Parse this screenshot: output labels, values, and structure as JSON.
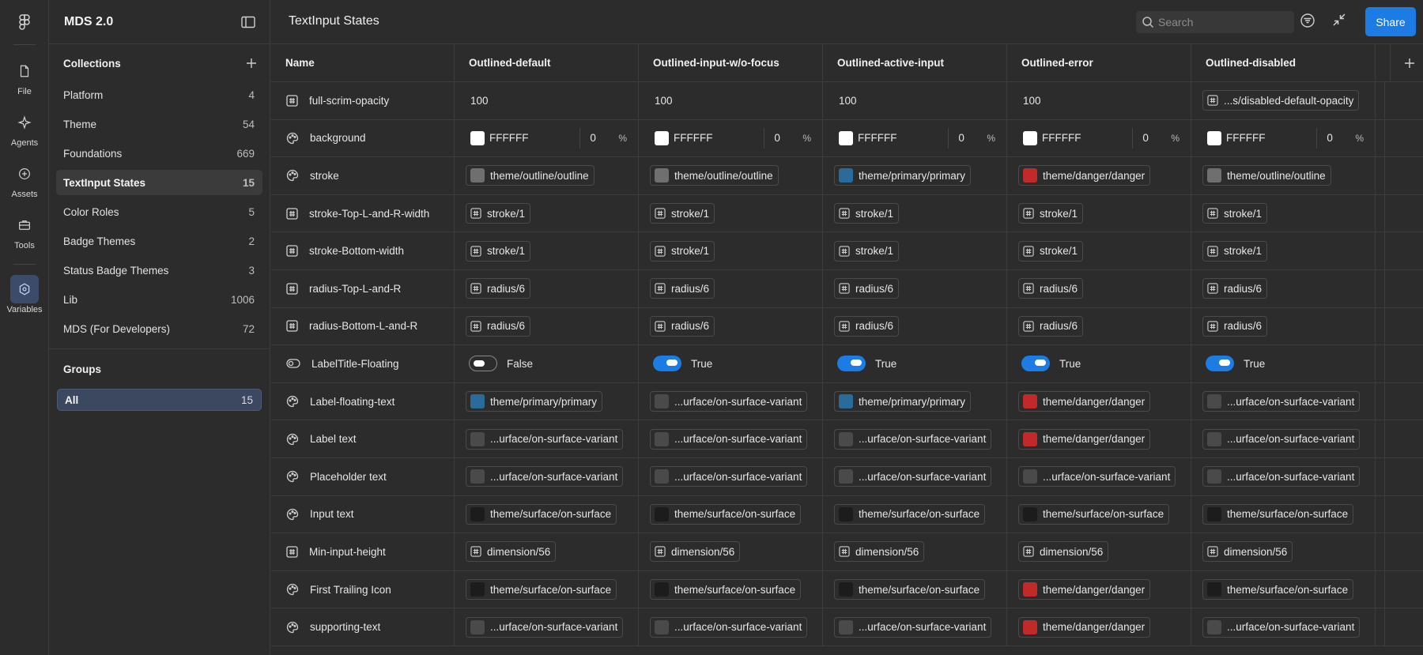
{
  "rail": {
    "items": [
      {
        "label": "File",
        "icon": "file-icon"
      },
      {
        "label": "Agents",
        "icon": "agents-icon"
      },
      {
        "label": "Assets",
        "icon": "assets-icon"
      },
      {
        "label": "Tools",
        "icon": "tools-icon"
      },
      {
        "label": "Variables",
        "icon": "variables-icon"
      }
    ]
  },
  "panel": {
    "title": "MDS 2.0",
    "collections_label": "Collections",
    "collections": [
      {
        "name": "Platform",
        "count": "4"
      },
      {
        "name": "Theme",
        "count": "54"
      },
      {
        "name": "Foundations",
        "count": "669"
      },
      {
        "name": "TextInput States",
        "count": "15"
      },
      {
        "name": "Color Roles",
        "count": "5"
      },
      {
        "name": "Badge Themes",
        "count": "2"
      },
      {
        "name": "Status Badge Themes",
        "count": "3"
      },
      {
        "name": "Lib",
        "count": "1006"
      },
      {
        "name": "MDS (For Developers)",
        "count": "72"
      }
    ],
    "groups_label": "Groups",
    "group_all": {
      "name": "All",
      "count": "15"
    }
  },
  "topbar": {
    "title": "TextInput States",
    "search_placeholder": "Search",
    "share_label": "Share"
  },
  "table": {
    "name_header": "Name",
    "modes": [
      "Outlined-default",
      "Outlined-input-w/o-focus",
      "Outlined-active-input",
      "Outlined-error",
      "Outlined-disabled"
    ],
    "rows": [
      {
        "name": "full-scrim-opacity",
        "type": "number",
        "cells": [
          {
            "kind": "plain",
            "text": "100"
          },
          {
            "kind": "plain",
            "text": "100"
          },
          {
            "kind": "plain",
            "text": "100"
          },
          {
            "kind": "plain",
            "text": "100"
          },
          {
            "kind": "alias",
            "text": "...s/disabled-default-opacity"
          }
        ]
      },
      {
        "name": "background",
        "type": "color",
        "cells": [
          {
            "kind": "color",
            "hex": "FFFFFF",
            "opacity": "0",
            "pct": "%"
          },
          {
            "kind": "color",
            "hex": "FFFFFF",
            "opacity": "0",
            "pct": "%"
          },
          {
            "kind": "color",
            "hex": "FFFFFF",
            "opacity": "0",
            "pct": "%"
          },
          {
            "kind": "color",
            "hex": "FFFFFF",
            "opacity": "0",
            "pct": "%"
          },
          {
            "kind": "color",
            "hex": "FFFFFF",
            "opacity": "0",
            "pct": "%"
          }
        ]
      },
      {
        "name": "stroke",
        "type": "color",
        "cells": [
          {
            "kind": "swatch",
            "text": "theme/outline/outline",
            "swatch": "#6f6f6f"
          },
          {
            "kind": "swatch",
            "text": "theme/outline/outline",
            "swatch": "#6f6f6f"
          },
          {
            "kind": "swatch",
            "text": "theme/primary/primary",
            "swatch": "#2b6b99"
          },
          {
            "kind": "swatch",
            "text": "theme/danger/danger",
            "swatch": "#c22a2a"
          },
          {
            "kind": "swatch",
            "text": "theme/outline/outline",
            "swatch": "#6f6f6f"
          }
        ]
      },
      {
        "name": "stroke-Top-L-and-R-width",
        "type": "number",
        "cells": [
          {
            "kind": "alias",
            "text": "stroke/1"
          },
          {
            "kind": "alias",
            "text": "stroke/1"
          },
          {
            "kind": "alias",
            "text": "stroke/1"
          },
          {
            "kind": "alias",
            "text": "stroke/1"
          },
          {
            "kind": "alias",
            "text": "stroke/1"
          }
        ]
      },
      {
        "name": "stroke-Bottom-width",
        "type": "number",
        "cells": [
          {
            "kind": "alias",
            "text": "stroke/1"
          },
          {
            "kind": "alias",
            "text": "stroke/1"
          },
          {
            "kind": "alias",
            "text": "stroke/1"
          },
          {
            "kind": "alias",
            "text": "stroke/1"
          },
          {
            "kind": "alias",
            "text": "stroke/1"
          }
        ]
      },
      {
        "name": "radius-Top-L-and-R",
        "type": "number",
        "cells": [
          {
            "kind": "alias",
            "text": "radius/6"
          },
          {
            "kind": "alias",
            "text": "radius/6"
          },
          {
            "kind": "alias",
            "text": "radius/6"
          },
          {
            "kind": "alias",
            "text": "radius/6"
          },
          {
            "kind": "alias",
            "text": "radius/6"
          }
        ]
      },
      {
        "name": "radius-Bottom-L-and-R",
        "type": "number",
        "cells": [
          {
            "kind": "alias",
            "text": "radius/6"
          },
          {
            "kind": "alias",
            "text": "radius/6"
          },
          {
            "kind": "alias",
            "text": "radius/6"
          },
          {
            "kind": "alias",
            "text": "radius/6"
          },
          {
            "kind": "alias",
            "text": "radius/6"
          }
        ]
      },
      {
        "name": "LabelTitle-Floating",
        "type": "boolean",
        "cells": [
          {
            "kind": "toggle",
            "on": false,
            "text": "False"
          },
          {
            "kind": "toggle",
            "on": true,
            "text": "True"
          },
          {
            "kind": "toggle",
            "on": true,
            "text": "True"
          },
          {
            "kind": "toggle",
            "on": true,
            "text": "True"
          },
          {
            "kind": "toggle",
            "on": true,
            "text": "True"
          }
        ]
      },
      {
        "name": "Label-floating-text",
        "type": "color",
        "cells": [
          {
            "kind": "swatch",
            "text": "theme/primary/primary",
            "swatch": "#2b6b99"
          },
          {
            "kind": "swatch",
            "text": "...urface/on-surface-variant",
            "swatch": "#4a4a4a"
          },
          {
            "kind": "swatch",
            "text": "theme/primary/primary",
            "swatch": "#2b6b99"
          },
          {
            "kind": "swatch",
            "text": "theme/danger/danger",
            "swatch": "#c22a2a"
          },
          {
            "kind": "swatch",
            "text": "...urface/on-surface-variant",
            "swatch": "#4a4a4a"
          }
        ]
      },
      {
        "name": "Label text",
        "type": "color",
        "cells": [
          {
            "kind": "swatch",
            "text": "...urface/on-surface-variant",
            "swatch": "#4a4a4a"
          },
          {
            "kind": "swatch",
            "text": "...urface/on-surface-variant",
            "swatch": "#4a4a4a"
          },
          {
            "kind": "swatch",
            "text": "...urface/on-surface-variant",
            "swatch": "#4a4a4a"
          },
          {
            "kind": "swatch",
            "text": "theme/danger/danger",
            "swatch": "#c22a2a"
          },
          {
            "kind": "swatch",
            "text": "...urface/on-surface-variant",
            "swatch": "#4a4a4a"
          }
        ]
      },
      {
        "name": "Placeholder text",
        "type": "color",
        "cells": [
          {
            "kind": "swatch",
            "text": "...urface/on-surface-variant",
            "swatch": "#4a4a4a"
          },
          {
            "kind": "swatch",
            "text": "...urface/on-surface-variant",
            "swatch": "#4a4a4a"
          },
          {
            "kind": "swatch",
            "text": "...urface/on-surface-variant",
            "swatch": "#4a4a4a"
          },
          {
            "kind": "swatch",
            "text": "...urface/on-surface-variant",
            "swatch": "#4a4a4a"
          },
          {
            "kind": "swatch",
            "text": "...urface/on-surface-variant",
            "swatch": "#4a4a4a"
          }
        ]
      },
      {
        "name": "Input text",
        "type": "color",
        "cells": [
          {
            "kind": "swatch",
            "text": "theme/surface/on-surface",
            "swatch": "#1c1c1c"
          },
          {
            "kind": "swatch",
            "text": "theme/surface/on-surface",
            "swatch": "#1c1c1c"
          },
          {
            "kind": "swatch",
            "text": "theme/surface/on-surface",
            "swatch": "#1c1c1c"
          },
          {
            "kind": "swatch",
            "text": "theme/surface/on-surface",
            "swatch": "#1c1c1c"
          },
          {
            "kind": "swatch",
            "text": "theme/surface/on-surface",
            "swatch": "#1c1c1c"
          }
        ]
      },
      {
        "name": "Min-input-height",
        "type": "number",
        "cells": [
          {
            "kind": "alias",
            "text": "dimension/56"
          },
          {
            "kind": "alias",
            "text": "dimension/56"
          },
          {
            "kind": "alias",
            "text": "dimension/56"
          },
          {
            "kind": "alias",
            "text": "dimension/56"
          },
          {
            "kind": "alias",
            "text": "dimension/56"
          }
        ]
      },
      {
        "name": "First Trailing Icon",
        "type": "color",
        "cells": [
          {
            "kind": "swatch",
            "text": "theme/surface/on-surface",
            "swatch": "#1c1c1c"
          },
          {
            "kind": "swatch",
            "text": "theme/surface/on-surface",
            "swatch": "#1c1c1c"
          },
          {
            "kind": "swatch",
            "text": "theme/surface/on-surface",
            "swatch": "#1c1c1c"
          },
          {
            "kind": "swatch",
            "text": "theme/danger/danger",
            "swatch": "#c22a2a"
          },
          {
            "kind": "swatch",
            "text": "theme/surface/on-surface",
            "swatch": "#1c1c1c"
          }
        ]
      },
      {
        "name": "supporting-text",
        "type": "color",
        "cells": [
          {
            "kind": "swatch",
            "text": "...urface/on-surface-variant",
            "swatch": "#4a4a4a"
          },
          {
            "kind": "swatch",
            "text": "...urface/on-surface-variant",
            "swatch": "#4a4a4a"
          },
          {
            "kind": "swatch",
            "text": "...urface/on-surface-variant",
            "swatch": "#4a4a4a"
          },
          {
            "kind": "swatch",
            "text": "theme/danger/danger",
            "swatch": "#c22a2a"
          },
          {
            "kind": "swatch",
            "text": "...urface/on-surface-variant",
            "swatch": "#4a4a4a"
          }
        ]
      }
    ]
  },
  "colors": {
    "accent": "#1c7ce3",
    "background": "#2c2c2c",
    "border": "#3d3d3d"
  }
}
